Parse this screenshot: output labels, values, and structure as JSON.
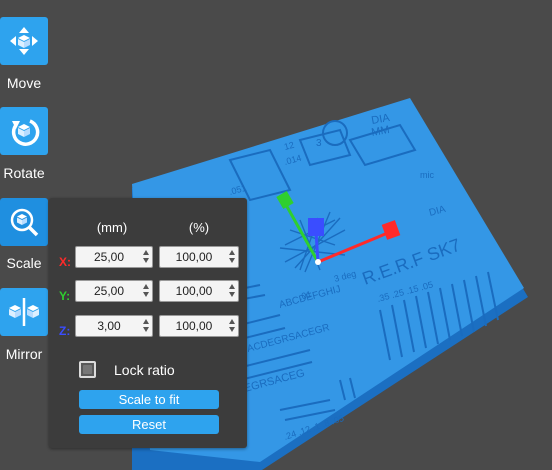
{
  "toolbar": {
    "move_label": "Move",
    "rotate_label": "Rotate",
    "scale_label": "Scale",
    "mirror_label": "Mirror"
  },
  "scale_panel": {
    "col_mm": "(mm)",
    "col_pct": "(%)",
    "rows": [
      {
        "axis": "X:",
        "color": "#ff2a2a",
        "mm": "25,00",
        "pct": "100,00"
      },
      {
        "axis": "Y:",
        "color": "#2fcf2f",
        "mm": "25,00",
        "pct": "100,00"
      },
      {
        "axis": "Z:",
        "color": "#3a4dff",
        "mm": "3,00",
        "pct": "100,00"
      }
    ],
    "lock_ratio_label": "Lock ratio",
    "lock_ratio_checked": false,
    "scale_to_fit_label": "Scale to fit",
    "reset_label": "Reset"
  },
  "model": {
    "text_ref": "R.E.R.F SK7",
    "text_dia": "DIA",
    "text_mm": "MM",
    "text_mic": "mic",
    "text_dia2": "DIA",
    "text_deg": "3 deg",
    "text_letters": "ABCDEFGHIJ",
    "text_letters2": "ACDEGRSACEGR",
    "text_letters3": "EGRSACEG",
    "text_nums": ".35 .25 .15 .05",
    "text_nums2": ".24 .12 .1 .8 .05",
    "text_top": "12",
    "text_3": "3",
    "text_014": ".014",
    "text_051": ".051",
    "text_01": ".01"
  },
  "colors": {
    "background": "#4a4a4a",
    "model": "#3497e6",
    "accent": "#2ea3ee",
    "panel": "#3c3c3c"
  }
}
